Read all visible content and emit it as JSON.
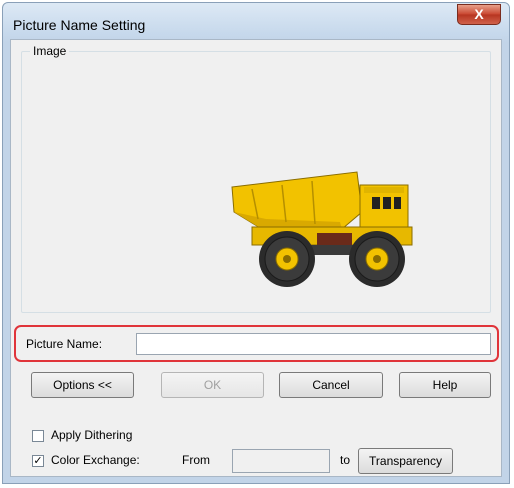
{
  "window": {
    "title": "Picture Name Setting",
    "close_symbol": "X"
  },
  "image_group": {
    "label": "Image",
    "picture_icon": "dump-truck-image"
  },
  "picture_name": {
    "label": "Picture Name:",
    "value": ""
  },
  "buttons": {
    "options": "Options <<",
    "ok": "OK",
    "cancel": "Cancel",
    "help": "Help"
  },
  "options": {
    "apply_dithering": {
      "label": "Apply Dithering",
      "checked": false
    },
    "color_exchange": {
      "label": "Color Exchange:",
      "checked": true,
      "check_mark": "✓"
    },
    "from_label": "From",
    "from_color": "",
    "to_label": "to",
    "transparency_button": "Transparency"
  },
  "colors": {
    "highlight": "#e0343a",
    "truck_body": "#f2c200",
    "tire": "#2b2b2b"
  }
}
